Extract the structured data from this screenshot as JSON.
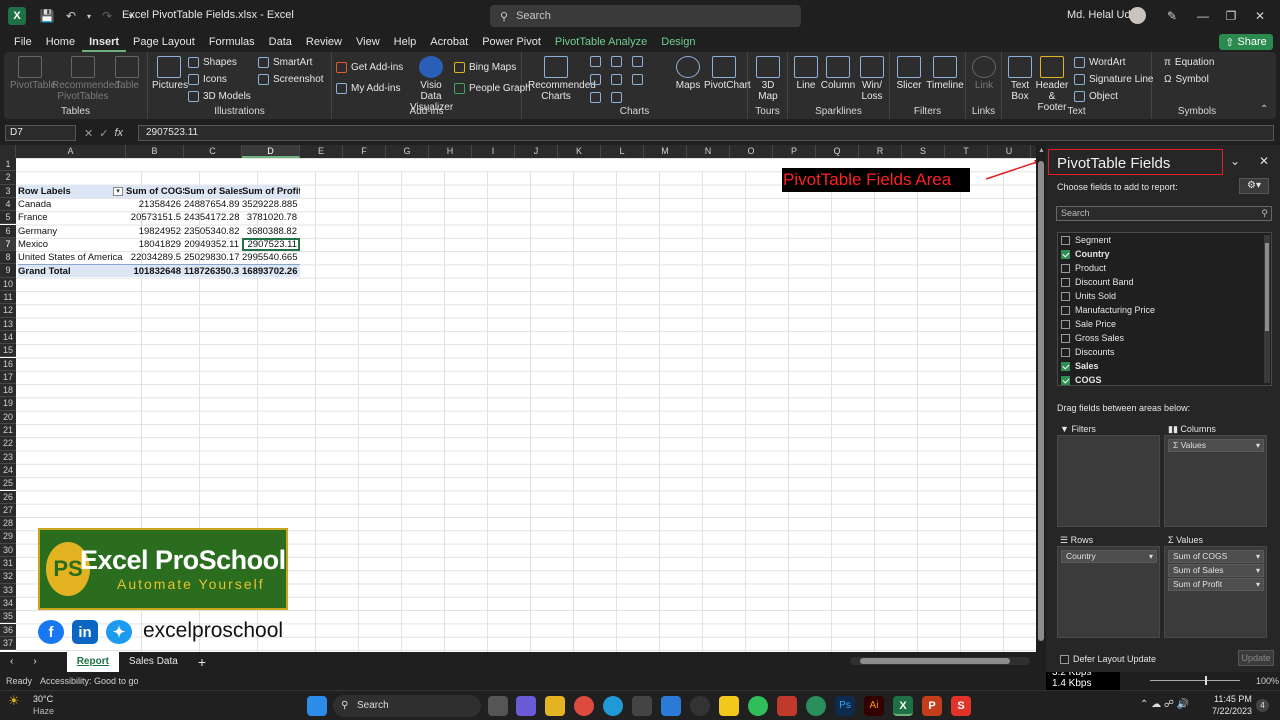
{
  "titlebar": {
    "title": "Excel PivotTable Fields.xlsx  -  Excel",
    "search_placeholder": "Search",
    "user": "Md. Helal Uddin"
  },
  "tabs": [
    "File",
    "Home",
    "Insert",
    "Page Layout",
    "Formulas",
    "Data",
    "Review",
    "View",
    "Help",
    "Acrobat",
    "Power Pivot",
    "PivotTable Analyze",
    "Design"
  ],
  "active_tab": "Insert",
  "share_label": "Share",
  "ribbon": {
    "tables": {
      "label": "Tables",
      "pivot": "PivotTable",
      "recommended": "Recommended PivotTables",
      "table": "Table"
    },
    "illustrations": {
      "label": "Illustrations",
      "pictures": "Pictures",
      "shapes": "Shapes",
      "icons": "Icons",
      "models": "3D Models",
      "smartart": "SmartArt",
      "screenshot": "Screenshot"
    },
    "addins": {
      "label": "Add-ins",
      "get": "Get Add-ins",
      "my": "My Add-ins",
      "visio": "Visio Data Visualizer",
      "bing": "Bing Maps",
      "people": "People Graph"
    },
    "charts": {
      "label": "Charts",
      "recommended": "Recommended Charts",
      "maps": "Maps",
      "pivotchart": "PivotChart"
    },
    "tours": {
      "label": "Tours",
      "map3d": "3D Map"
    },
    "sparklines": {
      "label": "Sparklines",
      "line": "Line",
      "column": "Column",
      "winloss": "Win/ Loss"
    },
    "filters": {
      "label": "Filters",
      "slicer": "Slicer",
      "timeline": "Timeline"
    },
    "links": {
      "label": "Links",
      "link": "Link"
    },
    "text": {
      "label": "Text",
      "textbox": "Text Box",
      "header": "Header & Footer",
      "wordart": "WordArt",
      "signature": "Signature Line",
      "object": "Object"
    },
    "symbols": {
      "label": "Symbols",
      "equation": "Equation",
      "symbol": "Symbol"
    }
  },
  "formula_bar": {
    "name_box": "D7",
    "formula": "2907523.11"
  },
  "columns": [
    "A",
    "B",
    "C",
    "D",
    "E",
    "F",
    "G",
    "H",
    "I",
    "J",
    "K",
    "L",
    "M",
    "N",
    "O",
    "P",
    "Q",
    "R",
    "S",
    "T",
    "U"
  ],
  "rows": [
    "1",
    "2",
    "3",
    "4",
    "5",
    "6",
    "7",
    "8",
    "9",
    "10",
    "11",
    "12",
    "13",
    "14",
    "15",
    "16",
    "17",
    "18",
    "19",
    "20",
    "21",
    "22",
    "23",
    "24",
    "25",
    "26",
    "27",
    "28",
    "29",
    "30",
    "31",
    "32",
    "33",
    "34",
    "35",
    "36",
    "37"
  ],
  "pivot": {
    "headers": [
      "Row Labels",
      "Sum of COGS",
      "Sum of  Sales",
      "Sum of Profit"
    ],
    "rows": [
      [
        "Canada",
        "21358426",
        "24887654.89",
        "3529228.885"
      ],
      [
        "France",
        "20573151.5",
        "24354172.28",
        "3781020.78"
      ],
      [
        "Germany",
        "19824952",
        "23505340.82",
        "3680388.82"
      ],
      [
        "Mexico",
        "18041829",
        "20949352.11",
        "2907523.11"
      ],
      [
        "United States of America",
        "22034289.5",
        "25029830.17",
        "2995540.665"
      ]
    ],
    "total": [
      "Grand Total",
      "101832648",
      "118726350.3",
      "16893702.26"
    ]
  },
  "annotation": "PivotTable Fields Area",
  "logo": {
    "title": "Excel ProSchool",
    "tagline": "Automate Yourself",
    "mark": "PS",
    "handle": "excelproschool"
  },
  "sheets": [
    "Report",
    "Sales Data"
  ],
  "active_sheet": "Report",
  "status": {
    "ready": "Ready",
    "accessibility": "Accessibility: Good to go",
    "zoom": "100%",
    "net_up": "3.2 Kbps",
    "net_down": "1.4 Kbps"
  },
  "pane": {
    "title": "PivotTable Fields",
    "choose": "Choose fields to add to report:",
    "search_placeholder": "Search",
    "fields": [
      {
        "name": "Segment",
        "checked": false
      },
      {
        "name": "Country",
        "checked": true
      },
      {
        "name": "Product",
        "checked": false
      },
      {
        "name": "Discount Band",
        "checked": false
      },
      {
        "name": "Units Sold",
        "checked": false
      },
      {
        "name": "Manufacturing Price",
        "checked": false
      },
      {
        "name": "Sale Price",
        "checked": false
      },
      {
        "name": "Gross Sales",
        "checked": false
      },
      {
        "name": "Discounts",
        "checked": false
      },
      {
        "name": "Sales",
        "checked": true
      },
      {
        "name": "COGS",
        "checked": true
      }
    ],
    "drag_label": "Drag fields between areas below:",
    "filters_label": "Filters",
    "columns_label": "Columns",
    "columns_items": [
      "Values"
    ],
    "rows_label": "Rows",
    "rows_items": [
      "Country"
    ],
    "values_label": "Values",
    "values_items": [
      "Sum of COGS",
      "Sum of  Sales",
      "Sum of Profit"
    ],
    "defer": "Defer Layout Update",
    "update": "Update"
  },
  "taskbar": {
    "weather_temp": "30°C",
    "weather_desc": "Haze",
    "search": "Search",
    "time": "11:45 PM",
    "date": "7/22/2023",
    "notif": "4"
  },
  "colors": {
    "excel_green": "#1e7145",
    "annotation_red": "#ff2020",
    "pivot_header": "#dde6f5"
  }
}
